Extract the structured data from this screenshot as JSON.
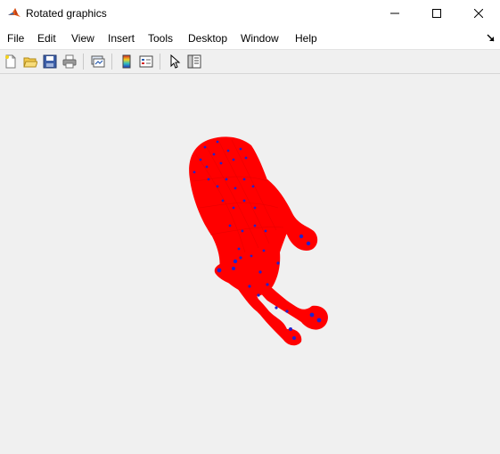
{
  "window": {
    "title": "Rotated graphics",
    "app_icon": "matlab-icon",
    "controls": [
      "minimize-icon",
      "maximize-icon",
      "close-icon"
    ]
  },
  "menubar": {
    "items": [
      {
        "label": "File"
      },
      {
        "label": "Edit"
      },
      {
        "label": "View"
      },
      {
        "label": "Insert"
      },
      {
        "label": "Tools"
      },
      {
        "label": "Desktop"
      },
      {
        "label": "Window"
      },
      {
        "label": "Help"
      }
    ],
    "dock_icon": "dock-arrow-icon"
  },
  "toolbar": {
    "buttons": [
      {
        "icon": "new-figure-icon"
      },
      {
        "icon": "open-file-icon"
      },
      {
        "icon": "save-figure-icon"
      },
      {
        "icon": "print-figure-icon"
      },
      {
        "icon": "link-plot-icon"
      },
      {
        "icon": "insert-colorbar-icon"
      },
      {
        "icon": "insert-legend-icon"
      },
      {
        "icon": "edit-plot-icon"
      },
      {
        "icon": "property-inspector-icon"
      }
    ]
  },
  "figure": {
    "content": "3D mesh of a hand, rotated",
    "face_color": "#ff0000",
    "vertex_color": "#2222cc",
    "background": "#f0f0f0"
  }
}
